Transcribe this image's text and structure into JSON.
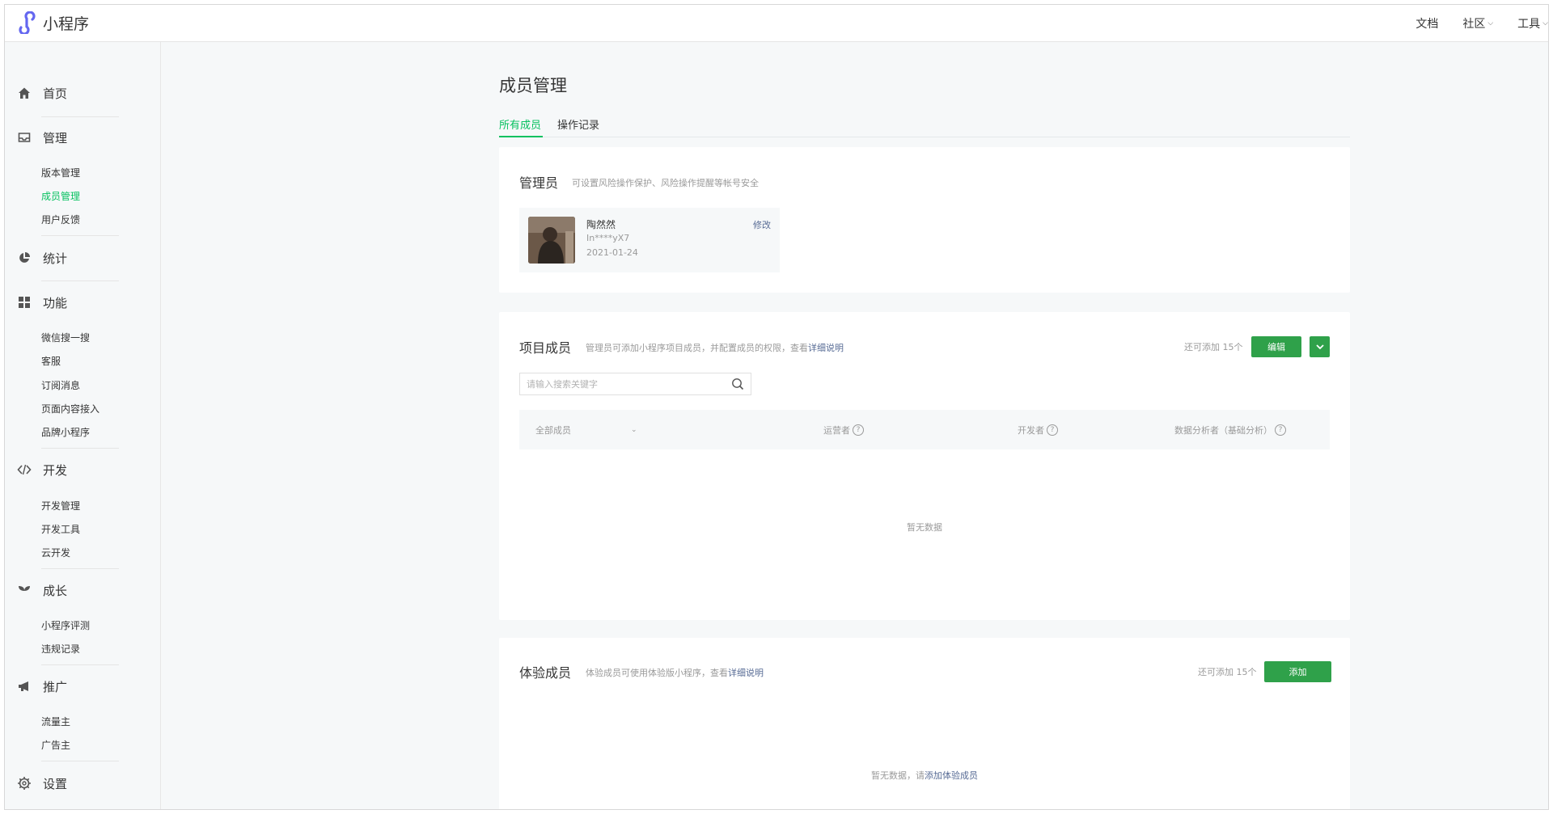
{
  "app": {
    "logo_text": "小程序"
  },
  "topnav": {
    "docs": "文档",
    "community": "社区",
    "tools": "工具"
  },
  "sidebar": {
    "groups": [
      {
        "label": "首页",
        "icon": "home-icon",
        "items": []
      },
      {
        "label": "管理",
        "icon": "inbox-icon",
        "items": [
          "版本管理",
          "成员管理",
          "用户反馈"
        ]
      },
      {
        "label": "统计",
        "icon": "pie-chart-icon",
        "items": []
      },
      {
        "label": "功能",
        "icon": "grid-icon",
        "items": [
          "微信搜一搜",
          "客服",
          "订阅消息",
          "页面内容接入",
          "品牌小程序"
        ]
      },
      {
        "label": "开发",
        "icon": "code-icon",
        "items": [
          "开发管理",
          "开发工具",
          "云开发"
        ]
      },
      {
        "label": "成长",
        "icon": "sprout-icon",
        "items": [
          "小程序评测",
          "违规记录"
        ]
      },
      {
        "label": "推广",
        "icon": "megaphone-icon",
        "items": [],
        "items2": [
          "流量主",
          "广告主"
        ]
      },
      {
        "label": "设置",
        "icon": "gear-icon",
        "items": []
      }
    ],
    "active_item": "成员管理"
  },
  "main": {
    "title": "成员管理",
    "tabs": [
      {
        "label": "所有成员",
        "active": true
      },
      {
        "label": "操作记录",
        "active": false
      }
    ],
    "admin_card": {
      "title": "管理员",
      "desc": "可设置风险操作保护、风险操作提醒等帐号安全",
      "admin": {
        "name": "陶然然",
        "id": "In****yX7",
        "date": "2021-01-24",
        "edit_label": "修改"
      }
    },
    "project_card": {
      "title": "项目成员",
      "desc": "管理员可添加小程序项目成员，并配置成员的权限，查看",
      "desc_link": "详细说明",
      "quota": "还可添加 15个",
      "edit_button": "编辑",
      "search_placeholder": "请输入搜索关键字",
      "columns": [
        "全部成员",
        "运营者",
        "开发者",
        "数据分析者（基础分析）"
      ],
      "empty_text": "暂无数据"
    },
    "experience_card": {
      "title": "体验成员",
      "desc": "体验成员可使用体验版小程序，查看",
      "desc_link": "详细说明",
      "quota": "还可添加 15个",
      "add_button": "添加",
      "empty_text": "暂无数据，请",
      "empty_link": "添加体验成员"
    }
  },
  "colors": {
    "accent_green": "#07c160",
    "button_green": "#2fa14a",
    "link_blue": "#576b95"
  }
}
